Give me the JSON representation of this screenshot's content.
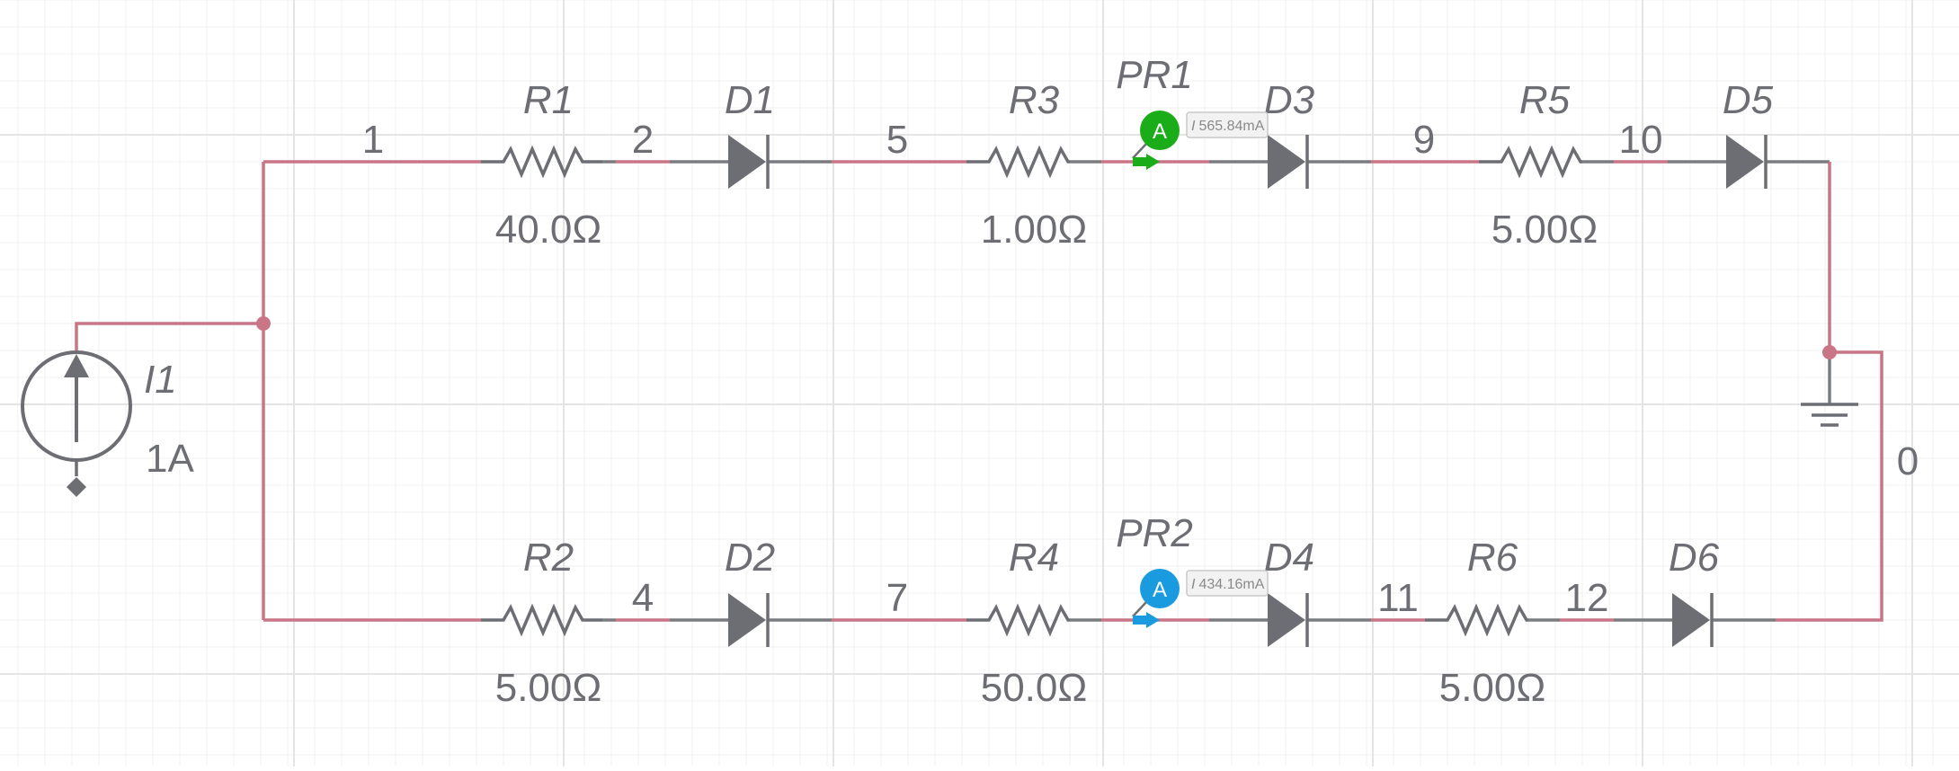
{
  "colors": {
    "wire_active": "#c97585",
    "wire_inactive": "#7a7c80",
    "component": "#6d6e73",
    "text": "#6d6e73",
    "grid_minor": "#f1f1f1",
    "grid_major": "#e4e4e4",
    "probe_pr1": "#1aad19",
    "probe_pr2": "#1a9be0",
    "probe_tag_bg": "#f2f2f2",
    "probe_tag_border": "#c9c9c9",
    "probe_tag_text": "#8a8a8a",
    "background": "#ffffff"
  },
  "source": {
    "name": "I1",
    "value": "1A"
  },
  "resistors": {
    "r1": {
      "name": "R1",
      "value": "40.0Ω"
    },
    "r2": {
      "name": "R2",
      "value": "5.00Ω"
    },
    "r3": {
      "name": "R3",
      "value": "1.00Ω"
    },
    "r4": {
      "name": "R4",
      "value": "50.0Ω"
    },
    "r5": {
      "name": "R5",
      "value": "5.00Ω"
    },
    "r6": {
      "name": "R6",
      "value": "5.00Ω"
    }
  },
  "diodes": {
    "d1": {
      "name": "D1"
    },
    "d2": {
      "name": "D2"
    },
    "d3": {
      "name": "D3"
    },
    "d4": {
      "name": "D4"
    },
    "d5": {
      "name": "D5"
    },
    "d6": {
      "name": "D6"
    }
  },
  "probes": {
    "pr1": {
      "name": "PR1",
      "badge": "A",
      "reading_symbol": "I",
      "reading_value": "565.84mA"
    },
    "pr2": {
      "name": "PR2",
      "badge": "A",
      "reading_symbol": "I",
      "reading_value": "434.16mA"
    }
  },
  "nodes": {
    "n0": "0",
    "n1": "1",
    "n2": "2",
    "n4": "4",
    "n5": "5",
    "n7": "7",
    "n9": "9",
    "n10": "10",
    "n11": "11",
    "n12": "12"
  },
  "icons": {
    "ground": "ground-icon",
    "current_source": "current-source-icon",
    "probe": "ammeter-probe-icon"
  }
}
